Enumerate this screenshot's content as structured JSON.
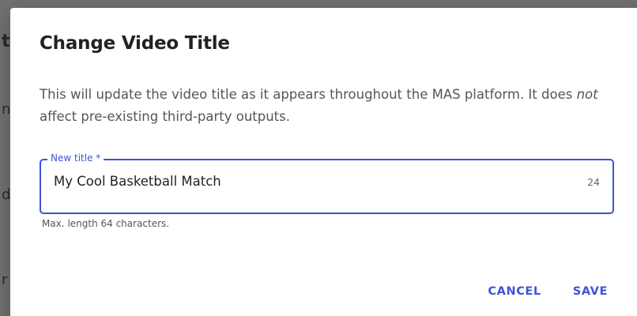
{
  "dialog": {
    "title": "Change Video Title",
    "description_part1": "This will update the video title as it appears throughout the MAS platform. It does ",
    "description_emphasis": "not",
    "description_part2": " affect pre-existing third-party outputs."
  },
  "field": {
    "label": "New title *",
    "value": "My Cool Basketball Match",
    "char_count": "24",
    "helper_text": "Max. length 64 characters."
  },
  "actions": {
    "cancel_label": "CANCEL",
    "save_label": "SAVE"
  },
  "colors": {
    "accent": "#3b55d6",
    "title": "#222222",
    "body_text": "#555555",
    "backdrop": "#6f6f6f"
  }
}
